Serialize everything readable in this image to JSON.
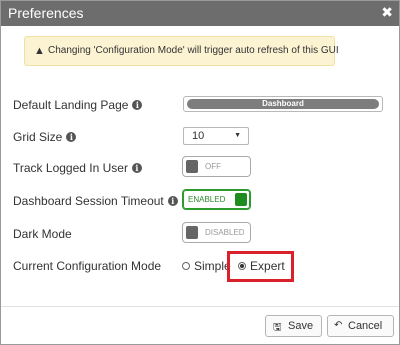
{
  "dialog": {
    "title": "Preferences",
    "close_glyph": "✖",
    "warning_glyph": "▲",
    "alert_text": "Changing 'Configuration Mode' will trigger auto refresh of this GUI"
  },
  "rows": {
    "landing": {
      "label": "Default Landing Page",
      "value": "Dashboard"
    },
    "grid": {
      "label": "Grid Size",
      "value": "10",
      "caret": "▼"
    },
    "track": {
      "label": "Track Logged In User",
      "value": "OFF"
    },
    "timeout": {
      "label": "Dashboard Session Timeout",
      "value": "ENABLED"
    },
    "dark": {
      "label": "Dark Mode",
      "value": "DISABLED"
    },
    "mode": {
      "label": "Current Configuration Mode",
      "options": [
        "Simple",
        "Expert"
      ],
      "selected": "Expert"
    }
  },
  "info_glyph": "i",
  "footer": {
    "save_label": "Save",
    "save_icon": "🖫",
    "cancel_label": "Cancel",
    "cancel_icon": "↶"
  }
}
